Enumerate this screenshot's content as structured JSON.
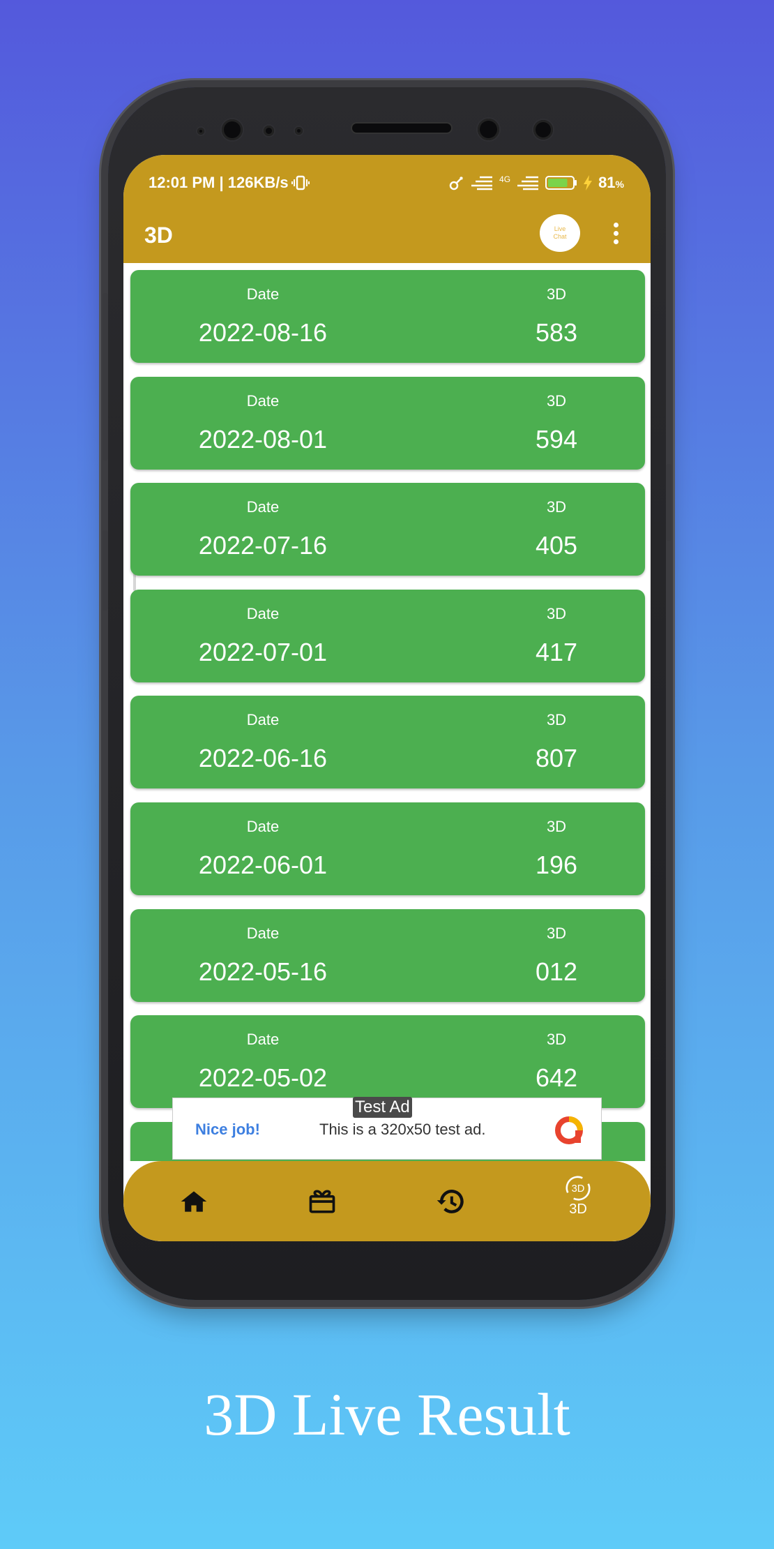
{
  "status_bar": {
    "time_speed": "12:01 PM | 126KB/s",
    "network": "4G",
    "battery": "81",
    "battery_unit": "%",
    "battery_level": 0.81
  },
  "app_bar": {
    "title": "3D",
    "live_chat_label": "Live Chat",
    "more_icon": "more-vert-icon"
  },
  "results": [
    {
      "date_label": "Date",
      "num_label": "3D",
      "date": "2022-08-16",
      "number": "583"
    },
    {
      "date_label": "Date",
      "num_label": "3D",
      "date": "2022-08-01",
      "number": "594"
    },
    {
      "date_label": "Date",
      "num_label": "3D",
      "date": "2022-07-16",
      "number": "405"
    },
    {
      "date_label": "Date",
      "num_label": "3D",
      "date": "2022-07-01",
      "number": "417"
    },
    {
      "date_label": "Date",
      "num_label": "3D",
      "date": "2022-06-16",
      "number": "807"
    },
    {
      "date_label": "Date",
      "num_label": "3D",
      "date": "2022-06-01",
      "number": "196"
    },
    {
      "date_label": "Date",
      "num_label": "3D",
      "date": "2022-05-16",
      "number": "012"
    },
    {
      "date_label": "Date",
      "num_label": "3D",
      "date": "2022-05-02",
      "number": "642"
    }
  ],
  "ad": {
    "tag": "Test Ad",
    "headline": "Nice job!",
    "body": "This is a 320x50 test ad."
  },
  "bottom_nav": {
    "items": [
      "home-icon",
      "gift-icon",
      "history-icon",
      "3d-refresh-icon"
    ],
    "active_badge": "3D",
    "active_label": "3D"
  },
  "colors": {
    "bar": "#c4991e",
    "card": "#4caf50",
    "background_top": "#5459dc",
    "background_bottom": "#5ecbf8"
  },
  "caption": "3D Live Result"
}
